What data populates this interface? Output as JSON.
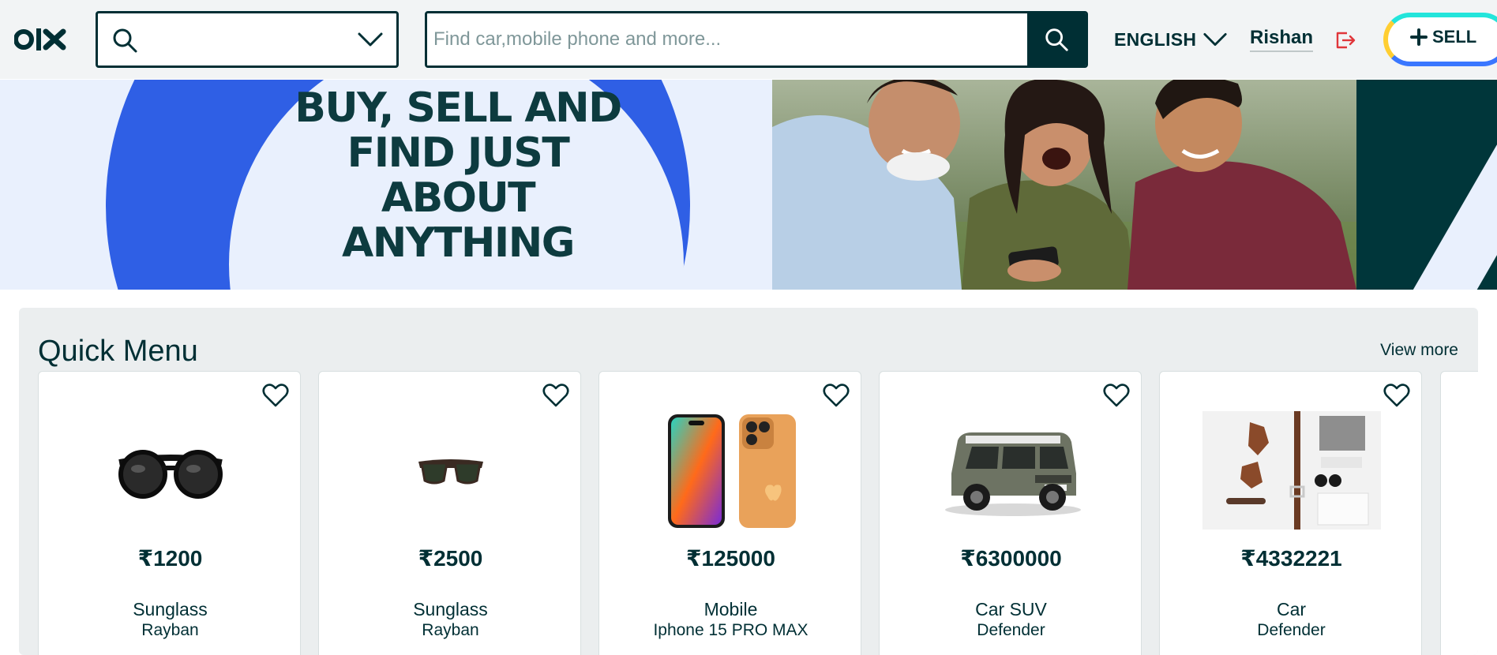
{
  "header": {
    "logo_text": "olx",
    "search": {
      "placeholder": "Find car,mobile phone and more..."
    },
    "language": "ENGLISH",
    "user": "Rishan",
    "sell_label": "SELL"
  },
  "banner": {
    "headline_lines": [
      "BUY, SELL AND",
      "FIND JUST ABOUT",
      "ANYTHING"
    ]
  },
  "quick_menu": {
    "title": "Quick Menu",
    "view_more": "View more",
    "items": [
      {
        "price": "₹1200",
        "category": "Sunglass",
        "subtitle": "Rayban",
        "icon": "round-sunglasses-image"
      },
      {
        "price": "₹2500",
        "category": "Sunglass",
        "subtitle": "Rayban",
        "icon": "wayfarer-sunglasses-image"
      },
      {
        "price": "₹125000",
        "category": "Mobile",
        "subtitle": "Iphone 15 PRO MAX",
        "icon": "iphone-image"
      },
      {
        "price": "₹6300000",
        "category": "Car SUV",
        "subtitle": "Defender",
        "icon": "suv-car-image"
      },
      {
        "price": "₹4332221",
        "category": "Car",
        "subtitle": "Defender",
        "icon": "fashion-accessories-image"
      }
    ]
  },
  "colors": {
    "brand_dark": "#002f34",
    "banner_blue": "#2f5fe5",
    "banner_bg": "#e9f0fd",
    "logout_red": "#e0363a",
    "sell_yellow": "#ffce32",
    "sell_blue": "#3a77ff",
    "sell_teal": "#23e5db"
  }
}
